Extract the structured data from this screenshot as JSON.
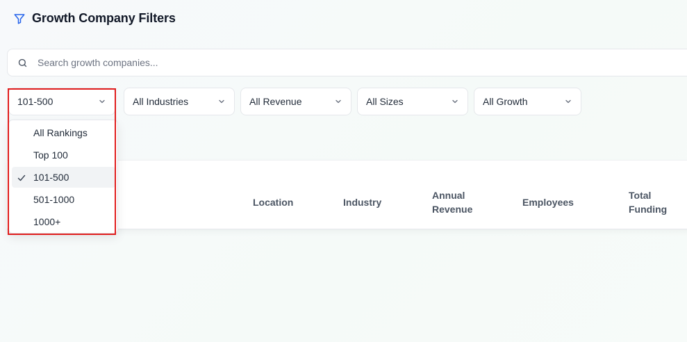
{
  "header": {
    "title": "Growth Company Filters",
    "icon": "filter-icon"
  },
  "search": {
    "placeholder": "Search growth companies...",
    "value": ""
  },
  "filters": {
    "ranking": "101-500",
    "industry": "All Industries",
    "revenue": "All Revenue",
    "size": "All Sizes",
    "growth": "All Growth"
  },
  "ranking_dropdown": {
    "options": [
      "All Rankings",
      "Top 100",
      "101-500",
      "501-1000",
      "1000+"
    ],
    "selected": "101-500"
  },
  "table": {
    "columns": {
      "location": "Location",
      "industry": "Industry",
      "annual_revenue_line1": "Annual",
      "annual_revenue_line2": "Revenue",
      "employees": "Employees",
      "total_funding_line1": "Total",
      "total_funding_line2": "Funding"
    }
  },
  "colors": {
    "accent": "#2563eb",
    "highlight": "#e11d1d"
  }
}
